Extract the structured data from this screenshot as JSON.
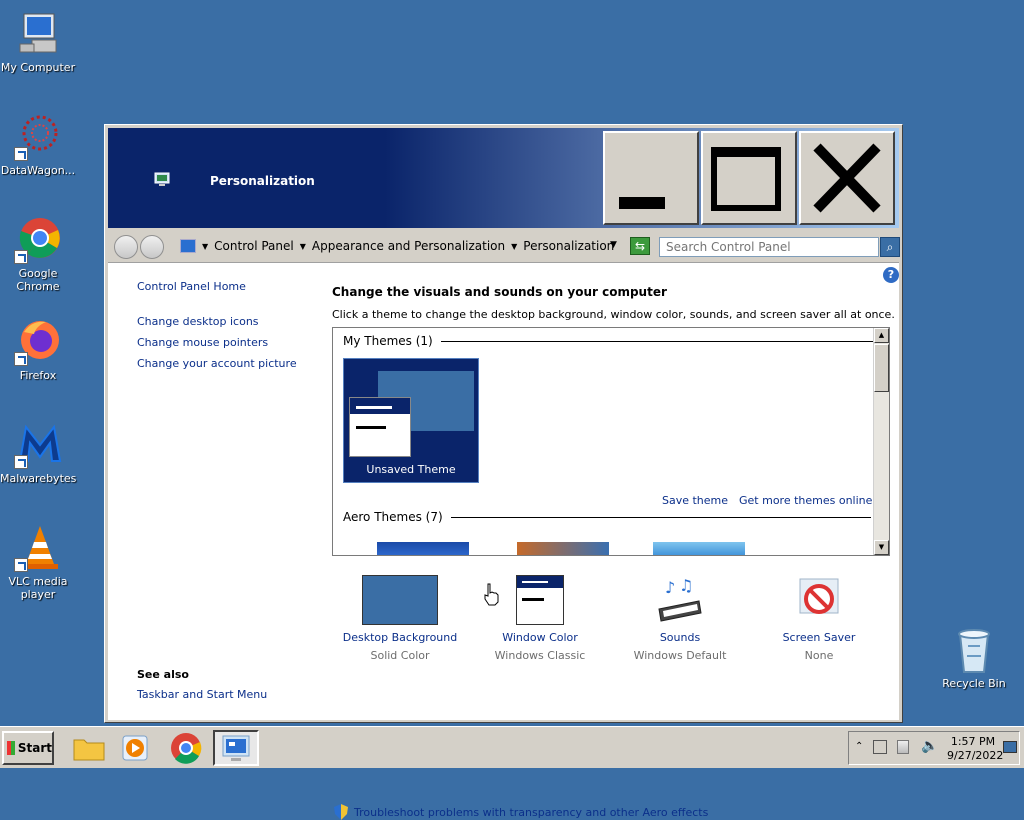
{
  "desktop": {
    "icons": [
      {
        "label": "My Computer"
      },
      {
        "label": "DataWagon..."
      },
      {
        "label": "Google Chrome"
      },
      {
        "label": "Firefox"
      },
      {
        "label": "Malwarebytes"
      },
      {
        "label": "VLC media player"
      },
      {
        "label": "Recycle Bin"
      }
    ]
  },
  "window": {
    "title": "Personalization",
    "address": {
      "crumbs": [
        "Control Panel",
        "Appearance and Personalization",
        "Personalization"
      ],
      "search_placeholder": "Search Control Panel"
    },
    "sidebar": {
      "home": "Control Panel Home",
      "links": [
        "Change desktop icons",
        "Change mouse pointers",
        "Change your account picture"
      ],
      "see_also_title": "See also",
      "see_also_links": [
        "Taskbar and Start Menu"
      ]
    },
    "main": {
      "title": "Change the visuals and sounds on your computer",
      "description": "Click a theme to change the desktop background, window color, sounds, and screen saver all at once.",
      "my_themes_heading": "My Themes (1)",
      "unsaved_theme": "Unsaved Theme",
      "save_theme": "Save theme",
      "get_more_themes": "Get more themes online",
      "aero_heading": "Aero Themes (7)"
    },
    "settings": [
      {
        "title": "Desktop Background",
        "sub": "Solid Color"
      },
      {
        "title": "Window Color",
        "sub": "Windows Classic"
      },
      {
        "title": "Sounds",
        "sub": "Windows Default"
      },
      {
        "title": "Screen Saver",
        "sub": "None"
      }
    ],
    "troubleshoot": "Troubleshoot problems with transparency and other Aero effects"
  },
  "taskbar": {
    "start_label": "Start",
    "time": "1:57 PM",
    "date": "9/27/2022"
  },
  "colors": {
    "desktop": "#3a6ea5",
    "title_dark": "#0a246a",
    "link": "#0b2f8a",
    "classic_face": "#d4d0c8"
  }
}
